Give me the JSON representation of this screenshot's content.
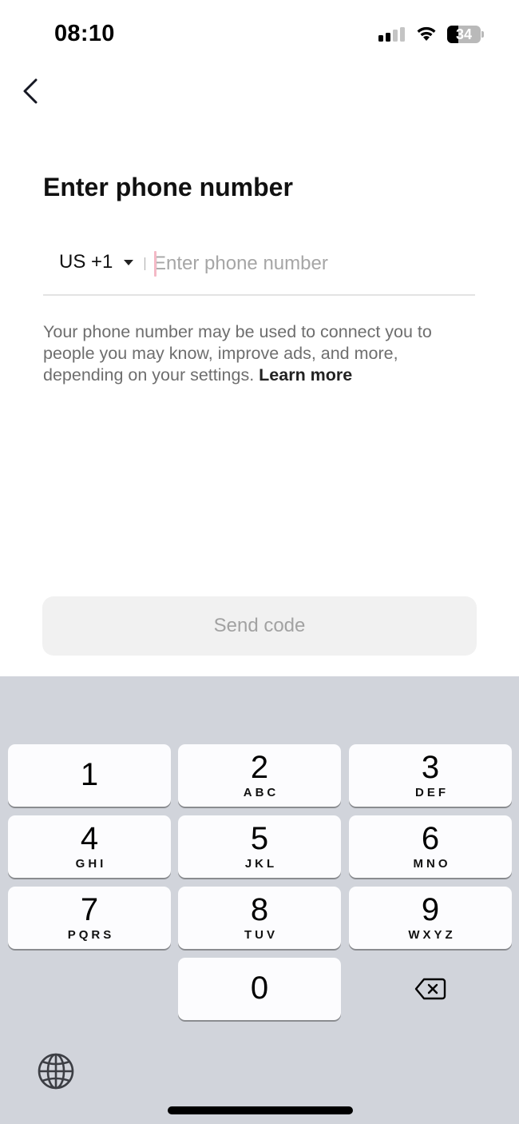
{
  "status_bar": {
    "time": "08:10",
    "battery_level": "34",
    "battery_fraction": 0.34,
    "signal_bars_active": 2,
    "signal_bars_total": 4
  },
  "nav": {
    "back_icon": "chevron-left-icon"
  },
  "page": {
    "title": "Enter phone number",
    "country_code": "US +1",
    "phone_input_value": "",
    "phone_input_placeholder": "Enter phone number",
    "info_text": "Your phone number may be used to connect you to people you may know, improve ads, and more, depending on your settings.",
    "learn_more_label": "Learn more",
    "send_button_label": "Send code"
  },
  "keyboard": {
    "keys": [
      {
        "digit": "1",
        "letters": ""
      },
      {
        "digit": "2",
        "letters": "ABC"
      },
      {
        "digit": "3",
        "letters": "DEF"
      },
      {
        "digit": "4",
        "letters": "GHI"
      },
      {
        "digit": "5",
        "letters": "JKL"
      },
      {
        "digit": "6",
        "letters": "MNO"
      },
      {
        "digit": "7",
        "letters": "PQRS"
      },
      {
        "digit": "8",
        "letters": "TUV"
      },
      {
        "digit": "9",
        "letters": "WXYZ"
      },
      {
        "digit": "0",
        "letters": ""
      }
    ],
    "backspace_icon": "delete-backward-icon",
    "globe_icon": "globe-icon"
  },
  "colors": {
    "keyboard_bg": "#d1d4db",
    "key_bg": "#fcfcfe",
    "button_disabled_bg": "#f1f1f1",
    "button_disabled_text": "#a2a2a2",
    "caret": "#f4b9c6"
  }
}
